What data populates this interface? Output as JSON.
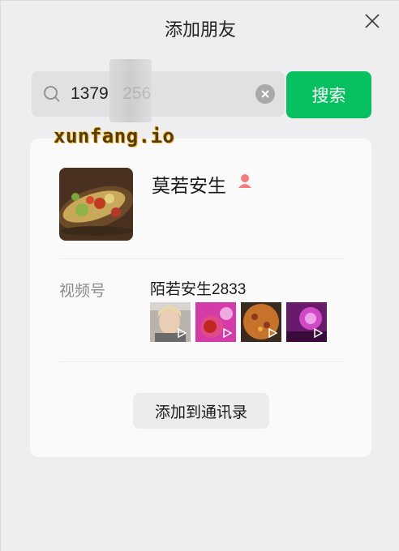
{
  "window": {
    "title": "添加朋友"
  },
  "search": {
    "value": "1379   256",
    "button_label": "搜索"
  },
  "watermark": {
    "text": "xunfang.io"
  },
  "result": {
    "name": "莫若安生",
    "gender_icon": "female-user-icon",
    "channel": {
      "label": "视频号",
      "name": "陌若安生2833",
      "thumbnails": [
        "video-thumb-selfie",
        "video-thumb-food-pink",
        "video-thumb-pizza",
        "video-thumb-food-purple"
      ]
    },
    "add_button_label": "添加到通讯录"
  },
  "colors": {
    "accent": "#07c160",
    "background": "#eeeef0",
    "card": "#fafafa",
    "gender_icon": "#f47b7b"
  }
}
